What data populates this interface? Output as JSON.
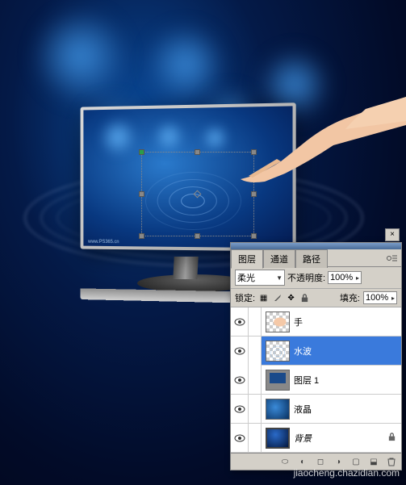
{
  "canvas": {
    "monitor_brand": "www.PS365.cn"
  },
  "panel": {
    "close": "×",
    "tabs": {
      "layers": "图层",
      "channels": "通道",
      "paths": "路径"
    },
    "blend_mode": "柔光",
    "opacity_label": "不透明度:",
    "opacity_value": "100%",
    "lock_label": "锁定:",
    "fill_label": "填充:",
    "fill_value": "100%",
    "layers": [
      {
        "name": "手"
      },
      {
        "name": "水波"
      },
      {
        "name": "图层 1"
      },
      {
        "name": "液晶"
      },
      {
        "name": "背景"
      }
    ]
  },
  "watermark": "jiaocheng.chazidian.com"
}
